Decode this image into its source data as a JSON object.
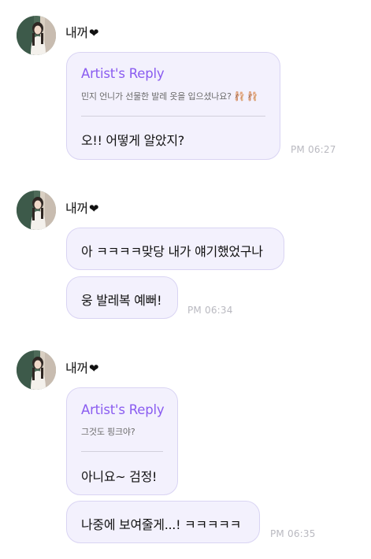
{
  "groups": [
    {
      "sender": "내꺼",
      "heart": "❤",
      "avatar_icon": "profile-photo-icon",
      "messages": [
        {
          "reply_title": "Artist's Reply",
          "reply_quote": "민지 언니가 선물한 발레 옷을 입으셨나요? 🩰 🩰",
          "text": "오!! 어떻게 알았지?"
        }
      ],
      "time": "PM 06:27"
    },
    {
      "sender": "내꺼",
      "heart": "❤",
      "avatar_icon": "profile-photo-icon",
      "messages": [
        {
          "text": "아 ㅋㅋㅋㅋ맞당 내가 얘기했었구나"
        },
        {
          "text": "웅 발레복 예뻐!"
        }
      ],
      "time": "PM 06:34"
    },
    {
      "sender": "내꺼",
      "heart": "❤",
      "avatar_icon": "profile-photo-icon",
      "messages": [
        {
          "reply_title": "Artist's Reply",
          "reply_quote": "그것도 핑크야?",
          "text": "아니요~ 검정!"
        },
        {
          "text": "나중에 보여줄게...! ㅋㅋㅋㅋㅋ"
        }
      ],
      "time": "PM 06:35"
    }
  ],
  "colors": {
    "bubble_bg": "#f3f1fd",
    "bubble_border": "#d9d4f3",
    "reply_title": "#8a5cf0",
    "timestamp": "#b9b9c0"
  }
}
